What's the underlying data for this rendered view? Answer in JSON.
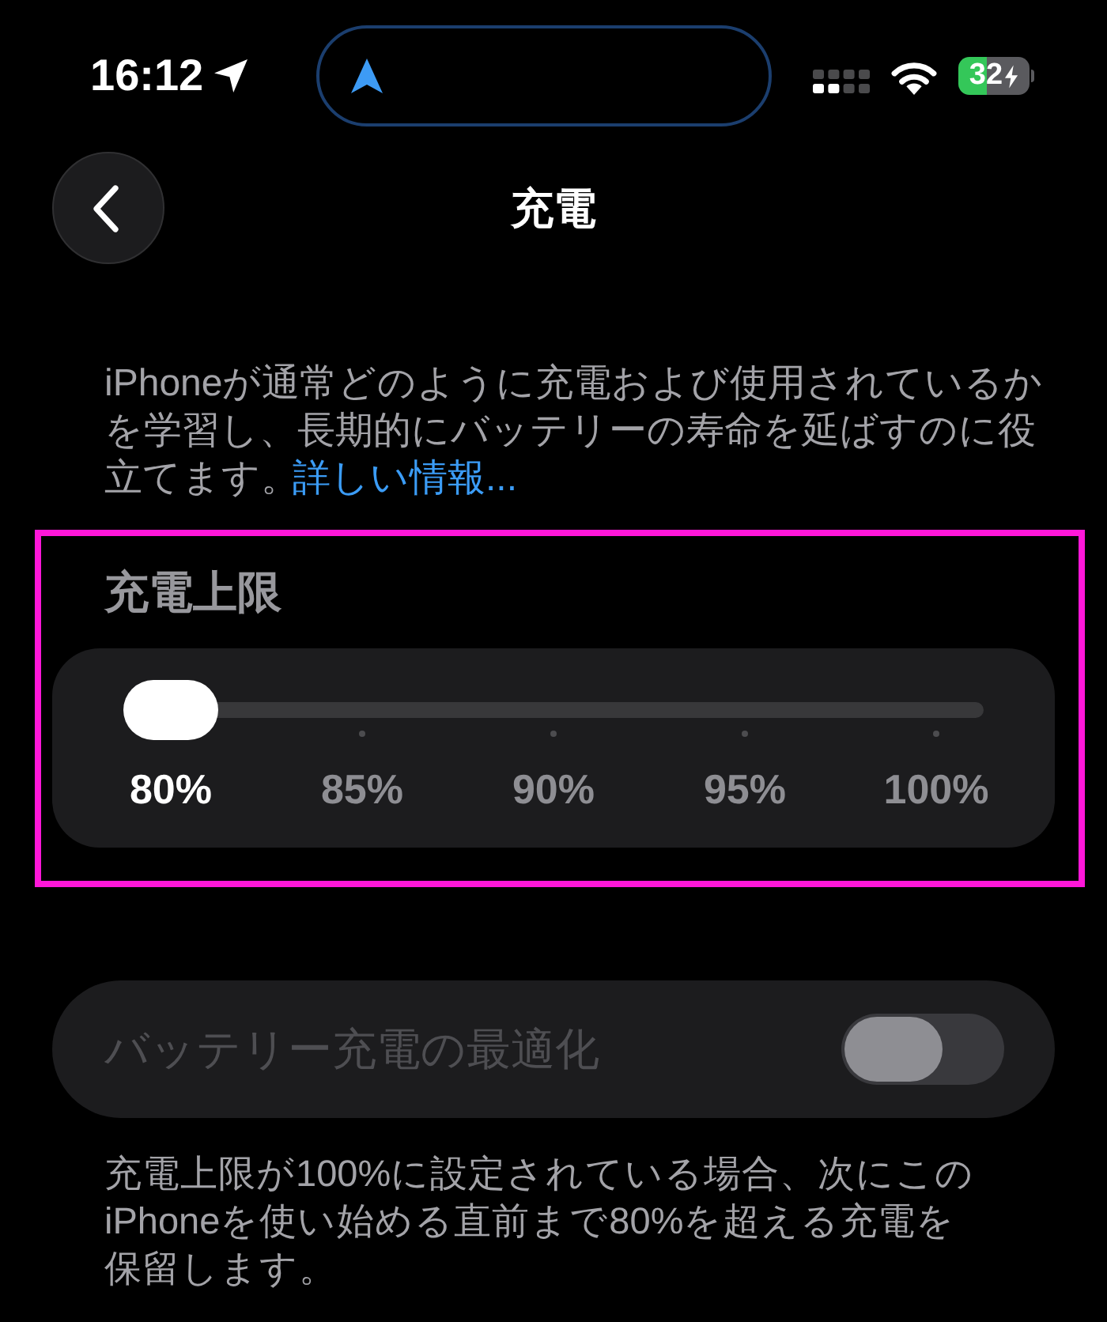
{
  "status_bar": {
    "time": "16:12",
    "battery": "32"
  },
  "nav": {
    "title": "充電"
  },
  "description": {
    "lines": [
      "iPhoneが通常どのように充電および使用されているか",
      "を学習し、長期的にバッテリーの寿命を延ばすのに役",
      "立てます。"
    ],
    "link": "詳しい情報..."
  },
  "charge_limit": {
    "highlighted": true,
    "title": "充電上限",
    "level": 0,
    "options": [
      {
        "label": "80%",
        "selected": true
      },
      {
        "label": "85%",
        "selected": false
      },
      {
        "label": "90%",
        "selected": false
      },
      {
        "label": "95%",
        "selected": false
      },
      {
        "label": "100%",
        "selected": false
      }
    ]
  },
  "optimize": {
    "label": "バッテリー充電の最適化",
    "on": false,
    "disabled": true
  },
  "footnote": {
    "lines": [
      "充電上限が100%に設定されている場合、次にこの",
      "iPhoneを使い始める直前まで80%を超える充電を",
      "保留します。"
    ]
  }
}
